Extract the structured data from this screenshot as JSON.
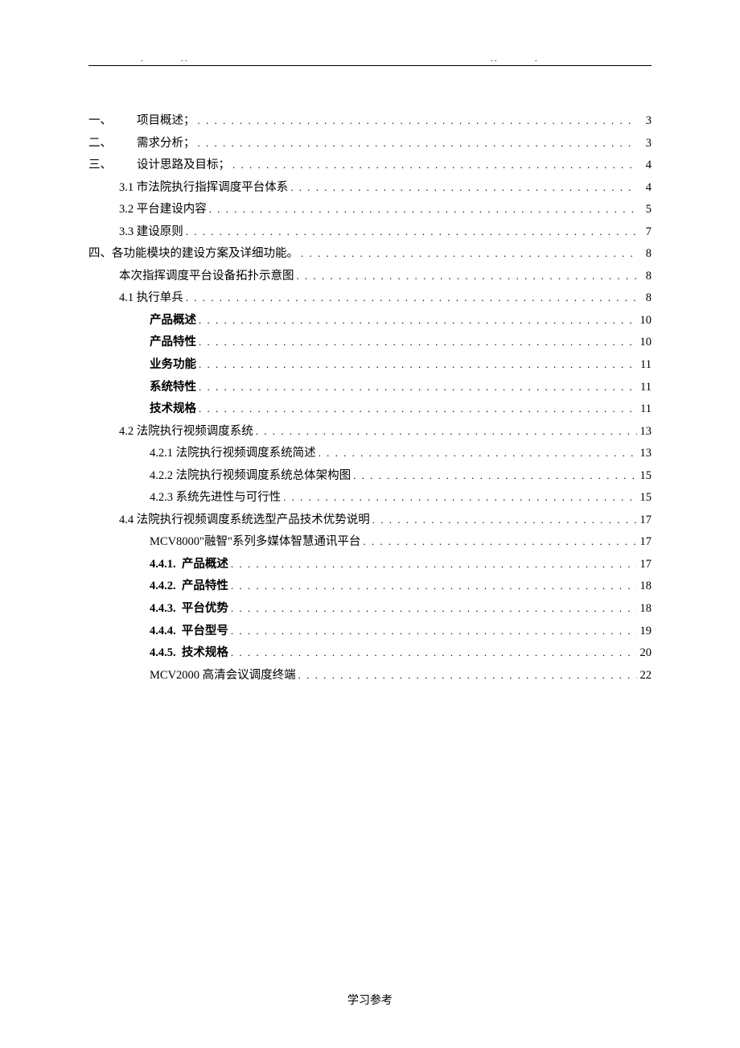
{
  "footer": "学习参考",
  "toc": [
    {
      "indent": 0,
      "num": "一、",
      "gap": "        ",
      "label": "项目概述；",
      "page": "3",
      "bold": false
    },
    {
      "indent": 0,
      "num": "二、",
      "gap": "        ",
      "label": "需求分析；",
      "page": "3",
      "bold": false
    },
    {
      "indent": 0,
      "num": "三、",
      "gap": "        ",
      "label": "设计思路及目标；",
      "page": "4",
      "bold": false
    },
    {
      "indent": 1,
      "num": "3.1",
      "gap": " ",
      "label": "市法院执行指挥调度平台体系",
      "page": "4",
      "bold": false
    },
    {
      "indent": 1,
      "num": "3.2",
      "gap": " ",
      "label": "平台建设内容",
      "page": "5",
      "bold": false
    },
    {
      "indent": 1,
      "num": "3.3",
      "gap": " ",
      "label": "建设原则",
      "page": "7",
      "bold": false
    },
    {
      "indent": 0,
      "num": "四、",
      "gap": "",
      "label": "各功能模块的建设方案及详细功能。",
      "page": "8",
      "bold": false
    },
    {
      "indent": 1,
      "num": "",
      "gap": "",
      "label": "本次指挥调度平台设备拓扑示意图",
      "page": "8",
      "bold": false
    },
    {
      "indent": 1,
      "num": "4.1",
      "gap": " ",
      "label": "执行单兵",
      "page": "8",
      "bold": false
    },
    {
      "indent": 2,
      "num": "",
      "gap": "",
      "label": "产品概述",
      "page": "10",
      "bold": true
    },
    {
      "indent": 2,
      "num": "",
      "gap": "",
      "label": "产品特性",
      "page": "10",
      "bold": true
    },
    {
      "indent": 2,
      "num": "",
      "gap": "",
      "label": "业务功能",
      "page": "11",
      "bold": true
    },
    {
      "indent": 2,
      "num": "",
      "gap": "",
      "label": "系统特性",
      "page": "11",
      "bold": true
    },
    {
      "indent": 2,
      "num": "",
      "gap": "",
      "label": "技术规格",
      "page": "11",
      "bold": true
    },
    {
      "indent": 1,
      "num": "4.2",
      "gap": " ",
      "label": "法院执行视频调度系统",
      "page": "13",
      "bold": false
    },
    {
      "indent": 2,
      "num": "4.2.1",
      "gap": " ",
      "label": "法院执行视频调度系统简述",
      "page": "13",
      "bold": false
    },
    {
      "indent": 2,
      "num": "4.2.2",
      "gap": " ",
      "label": "法院执行视频调度系统总体架构图",
      "page": "15",
      "bold": false
    },
    {
      "indent": 2,
      "num": "4.2.3",
      "gap": " ",
      "label": "系统先进性与可行性",
      "page": "15",
      "bold": false
    },
    {
      "indent": 1,
      "num": "4.4",
      "gap": " ",
      "label": "法院执行视频调度系统选型产品技术优势说明",
      "page": "17",
      "bold": false
    },
    {
      "indent": 2,
      "num": "",
      "gap": "",
      "label": "MCV8000\"融智\"系列多媒体智慧通讯平台",
      "page": "17",
      "bold": false
    },
    {
      "indent": 2,
      "num": "4.4.1.",
      "gap": "  ",
      "label": "产品概述",
      "page": "17",
      "bold": true
    },
    {
      "indent": 2,
      "num": "4.4.2.",
      "gap": "  ",
      "label": "产品特性",
      "page": "18",
      "bold": true
    },
    {
      "indent": 2,
      "num": "4.4.3.",
      "gap": "  ",
      "label": "平台优势",
      "page": "18",
      "bold": true
    },
    {
      "indent": 2,
      "num": "4.4.4.",
      "gap": "  ",
      "label": "平台型号",
      "page": "19",
      "bold": true
    },
    {
      "indent": 2,
      "num": "4.4.5.",
      "gap": "  ",
      "label": "技术规格",
      "page": "20",
      "bold": true
    },
    {
      "indent": 2,
      "num": "",
      "gap": "",
      "label": "MCV2000 高清会议调度终端",
      "page": "22",
      "bold": false
    }
  ]
}
